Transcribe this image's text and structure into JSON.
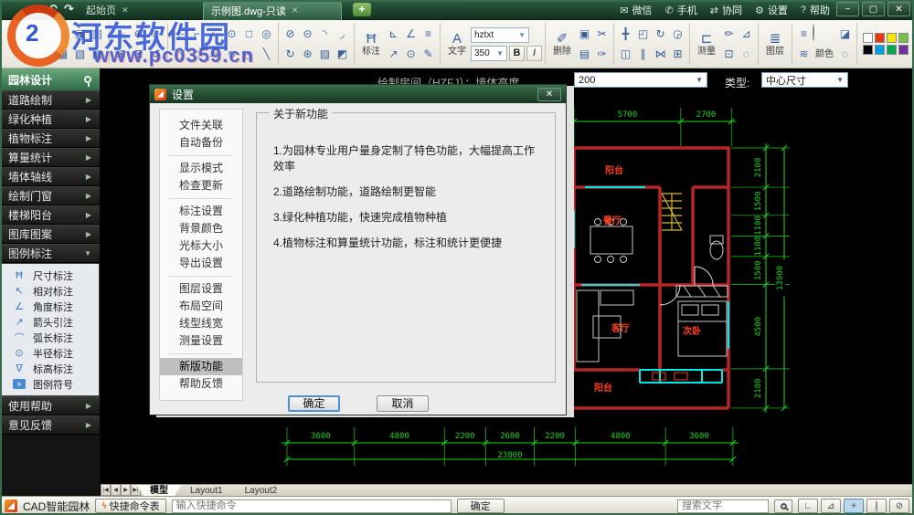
{
  "window": {
    "back": "↶",
    "forward": "↷",
    "tabs": [
      {
        "label": "起始页"
      },
      {
        "label": "示例图.dwg-只读"
      }
    ],
    "tab_close": "✕",
    "new_tab": "+",
    "menu": [
      {
        "g": "✉",
        "n": "wechat-icon",
        "label": "微信"
      },
      {
        "g": "✆",
        "n": "phone-icon",
        "label": "手机"
      },
      {
        "g": "⇄",
        "n": "collaboration-icon",
        "label": "协同"
      },
      {
        "g": "⚙",
        "n": "settings-icon",
        "label": "设置"
      },
      {
        "g": "?",
        "n": "help-icon",
        "label": "帮助"
      }
    ],
    "min": "−",
    "max": "▢",
    "close": "✕"
  },
  "watermark": {
    "site": "河东软件园",
    "url": "www.pc0359.cn",
    "logo_mark": "2"
  },
  "command_bar": {
    "label": "绘制房间（HZFJ）：墙体高度",
    "value": "200",
    "type_label": "类型:",
    "type_value": "中心尺寸"
  },
  "toolbar": {
    "color_label": "颜色",
    "text": {
      "big": "A",
      "label": "文字",
      "font": "hztxt",
      "size": "350",
      "bold": "B",
      "italic": "I"
    },
    "swatches": [
      "#ffffff",
      "#e8380d",
      "#f0e800",
      "#76c043",
      "#000000",
      "#00a0e8",
      "#00a650",
      "#7030a0"
    ],
    "groups": [
      {
        "kind": "grid",
        "name": "file-group",
        "cells": [
          {
            "g": "▤",
            "n": "open-file-icon"
          },
          {
            "g": "▣",
            "n": "save-icon"
          },
          {
            "g": "▥",
            "n": "save-as-icon"
          },
          {
            "g": "▦",
            "n": "print-icon"
          },
          {
            "g": "▧",
            "n": "export-pdf-icon"
          },
          {
            "g": "▩",
            "n": "export-image-icon"
          }
        ]
      },
      {
        "kind": "grid",
        "name": "view-group",
        "cells": [
          {
            "g": "+",
            "n": "pan-icon"
          },
          {
            "g": "⊕",
            "n": "zoom-in-icon"
          },
          {
            "g": "⊖",
            "n": "zoom-out-icon"
          },
          {
            "g": "⊞",
            "n": "zoom-window-icon"
          },
          {
            "g": "⊠",
            "n": "zoom-extents-icon"
          },
          {
            "g": "↺",
            "n": "zoom-previous-icon"
          }
        ]
      },
      {
        "kind": "grid",
        "name": "draw-group",
        "cells": [
          {
            "g": "┼",
            "n": "point-icon"
          },
          {
            "g": "⌐",
            "n": "polyline-icon"
          },
          {
            "g": "◜",
            "n": "arc-icon"
          },
          {
            "g": "⊙",
            "n": "circle-icon"
          },
          {
            "g": "□",
            "n": "rectangle-icon"
          },
          {
            "g": "◎",
            "n": "ellipse-icon"
          },
          {
            "g": "△",
            "n": "triangle-icon"
          },
          {
            "g": "◇",
            "n": "polygon-icon"
          },
          {
            "g": "▱",
            "n": "parallelogram-icon"
          },
          {
            "g": "∿",
            "n": "spline-icon"
          },
          {
            "g": "◺",
            "n": "wedge-icon"
          },
          {
            "g": "╲",
            "n": "construction-line-icon"
          }
        ]
      },
      {
        "kind": "grid",
        "name": "modify-group",
        "cells": [
          {
            "g": "⊘",
            "n": "break-icon"
          },
          {
            "g": "⊝",
            "n": "trim-icon"
          },
          {
            "g": "◝",
            "n": "fillet-icon"
          },
          {
            "g": "◞",
            "n": "chamfer-icon"
          },
          {
            "g": "↻",
            "n": "rotate-copy-icon"
          },
          {
            "g": "⊛",
            "n": "polar-array-icon"
          },
          {
            "g": "▨",
            "n": "hatch-icon"
          },
          {
            "g": "◩",
            "n": "gradient-icon"
          }
        ]
      },
      {
        "kind": "caption",
        "name": "dimension-group",
        "g": "Ħ",
        "n": "dimension-icon",
        "label": "标注",
        "cells": [
          {
            "g": "⊾",
            "n": "aligned-dim-icon"
          },
          {
            "g": "∠",
            "n": "angular-dim-icon"
          },
          {
            "g": "≡",
            "n": "baseline-dim-icon"
          },
          {
            "g": "↗",
            "n": "leader-icon"
          },
          {
            "g": "⊙",
            "n": "radius-dim-icon"
          },
          {
            "g": "✎",
            "n": "quick-dim-icon"
          }
        ]
      },
      {
        "kind": "text",
        "name": "text-group"
      },
      {
        "kind": "caption",
        "name": "delete-group",
        "g": "✐",
        "n": "eraser-icon",
        "label": "删除",
        "cells": [
          {
            "g": "▣",
            "n": "copy-icon"
          },
          {
            "g": "✂",
            "n": "cut-icon"
          },
          {
            "g": "▤",
            "n": "paste-icon"
          },
          {
            "g": "✑",
            "n": "format-painter-icon"
          }
        ]
      },
      {
        "kind": "grid",
        "name": "transform-group",
        "cells": [
          {
            "g": "╋",
            "n": "move-icon"
          },
          {
            "g": "◰",
            "n": "scale-icon"
          },
          {
            "g": "↻",
            "n": "rotate-icon"
          },
          {
            "g": "◶",
            "n": "orbit-icon"
          },
          {
            "g": "◫",
            "n": "offset-icon"
          },
          {
            "g": "∥",
            "n": "stretch-icon"
          },
          {
            "g": "⋈",
            "n": "mirror-icon"
          },
          {
            "g": "⊞",
            "n": "array-icon"
          }
        ]
      },
      {
        "kind": "caption",
        "name": "measure-group",
        "g": "⊏",
        "n": "measure-icon",
        "label": "测量",
        "cells": [
          {
            "g": "✏",
            "n": "measure-draw-icon"
          },
          {
            "g": "⊿",
            "n": "area-measure-icon"
          },
          {
            "g": "⊡",
            "n": "annotate-icon"
          },
          {
            "g": "◌",
            "n": "revision-cloud-icon"
          }
        ]
      },
      {
        "kind": "caption",
        "name": "layer-group",
        "g": "≣",
        "n": "layers-icon",
        "label": "图层"
      },
      {
        "kind": "colors",
        "name": "color-group"
      },
      {
        "kind": "swatches",
        "name": "swatch-group"
      }
    ]
  },
  "sidebar": {
    "header": "园林设计",
    "items": [
      {
        "label": "道路绘制"
      },
      {
        "label": "绿化种植"
      },
      {
        "label": "植物标注"
      },
      {
        "label": "算量统计"
      },
      {
        "label": "墙体轴线"
      },
      {
        "label": "绘制门窗"
      },
      {
        "label": "楼梯阳台"
      },
      {
        "label": "图库图案"
      },
      {
        "label": "图例标注",
        "expanded": true
      }
    ],
    "legend": [
      {
        "g": "Ħ",
        "n": "linear-dim-icon",
        "label": "尺寸标注"
      },
      {
        "g": "↖",
        "n": "relative-dim-icon",
        "label": "相对标注"
      },
      {
        "g": "∠",
        "n": "angle-dim-icon",
        "label": "角度标注"
      },
      {
        "g": "↗",
        "n": "arrow-leader-icon",
        "label": "箭头引注"
      },
      {
        "g": "⌒",
        "n": "arc-length-icon",
        "label": "弧长标注"
      },
      {
        "g": "⊙",
        "n": "radius-annotate-icon",
        "label": "半径标注"
      },
      {
        "g": "∇",
        "n": "elevation-icon",
        "label": "标高标注"
      },
      {
        "g": "»",
        "n": "legend-symbol-icon",
        "label": "图例符号",
        "badge": true
      }
    ],
    "footer": [
      {
        "label": "使用帮助"
      },
      {
        "label": "意见反馈"
      }
    ]
  },
  "dialog": {
    "title": "设置",
    "close": "✕",
    "nav_groups": [
      [
        "文件关联",
        "自动备份"
      ],
      [
        "显示模式",
        "检查更新"
      ],
      [
        "标注设置",
        "背景颜色",
        "光标大小",
        "导出设置"
      ],
      [
        "图层设置",
        "布局空间",
        "线型线宽",
        "测量设置"
      ],
      [
        "新版功能",
        "帮助反馈"
      ]
    ],
    "selected": "新版功能",
    "box_title": "关于新功能",
    "features": [
      "1.为园林专业用户量身定制了特色功能，大幅提高工作效率",
      "2.道路绘制功能，道路绘制更智能",
      "3.绿化种植功能，快速完成植物种植",
      "4.植物标注和算量统计功能，标注和统计更便捷"
    ],
    "ok": "确定",
    "cancel": "取消"
  },
  "drawing": {
    "top_dims": [
      "5700",
      "2700"
    ],
    "right_dims": [
      "2100",
      "1500",
      "1100",
      "1100",
      "1500",
      "4500",
      "2100"
    ],
    "right_total": "13900",
    "bottom_dims": [
      "3600",
      "4800",
      "2200",
      "2600",
      "2200",
      "4800",
      "3600"
    ],
    "bottom_total": "23800",
    "rooms": [
      {
        "label": "阳台"
      },
      {
        "label": "餐厅"
      },
      {
        "label": "客厅"
      },
      {
        "label": "次卧"
      },
      {
        "label": "阳台"
      }
    ],
    "colors": {
      "dim": "#1ad41a",
      "wall": "#b82525",
      "window": "#00e8e8",
      "label": "#ff3f1f",
      "stairs": "#d6b81f"
    }
  },
  "tabs_bar": {
    "arrows": [
      "|◀",
      "◀",
      "▶",
      "▶|"
    ],
    "tabs": [
      {
        "label": "模型",
        "active": true
      },
      {
        "label": "Layout1"
      },
      {
        "label": "Layout2"
      }
    ]
  },
  "status_bar": {
    "app": "CAD智能园林",
    "shortcut_button": "快捷命令表",
    "cmd_placeholder": "输入快捷命令",
    "ok": "确定",
    "search_placeholder": "搜索文字",
    "toggles": [
      {
        "g": "∟",
        "n": "ortho-toggle"
      },
      {
        "g": "⊿",
        "n": "osnap-toggle"
      },
      {
        "g": "+",
        "n": "crosshair-toggle",
        "active": true
      },
      {
        "g": "",
        "n": "color-wheel-toggle",
        "wheel": true
      },
      {
        "g": "⊘",
        "n": "linetype-toggle"
      }
    ]
  }
}
